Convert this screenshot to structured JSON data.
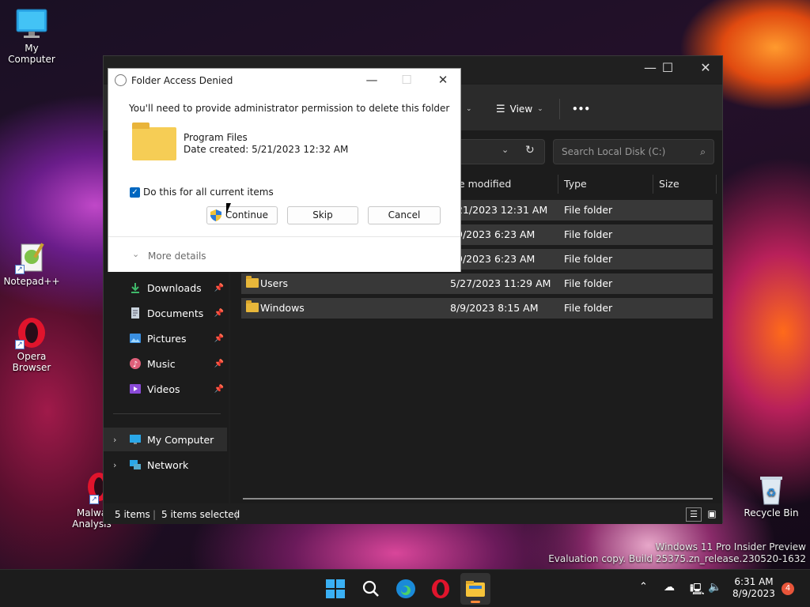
{
  "desktop": {
    "icons": [
      {
        "label": "My Computer"
      },
      {
        "label": "Notepad++"
      },
      {
        "label": "Opera Browser"
      },
      {
        "label": "Malwa Analysis"
      },
      {
        "label": "Recycle Bin"
      }
    ],
    "watermark": {
      "line1": "Windows 11 Pro Insider Preview",
      "line2": "Evaluation copy. Build 25375.zn_release.230520-1632"
    }
  },
  "explorer": {
    "toolbar": {
      "view_label": "View",
      "more_label": "•••"
    },
    "search_placeholder": "Search Local Disk (C:)",
    "columns": {
      "date": "te modified",
      "type": "Type",
      "size": "Size"
    },
    "rows": [
      {
        "name": "",
        "date": "21/2023 12:31 AM",
        "type": "File folder"
      },
      {
        "name": "",
        "date": "9/2023 6:23 AM",
        "type": "File folder"
      },
      {
        "name": "",
        "date": "9/2023 6:23 AM",
        "type": "File folder"
      },
      {
        "name": "Users",
        "date": "5/27/2023 11:29 AM",
        "type": "File folder"
      },
      {
        "name": "Windows",
        "date": "8/9/2023 8:15 AM",
        "type": "File folder"
      }
    ],
    "sidebar": {
      "downloads": "Downloads",
      "documents": "Documents",
      "pictures": "Pictures",
      "music": "Music",
      "videos": "Videos",
      "my_computer": "My Computer",
      "network": "Network"
    },
    "status": {
      "items": "5 items",
      "selected": "5 items selected"
    }
  },
  "dialog": {
    "title": "Folder Access Denied",
    "message": "You'll need to provide administrator permission to delete this folder",
    "folder_name": "Program Files",
    "date_created": "Date created: 5/21/2023 12:32 AM",
    "checkbox_label": "Do this for all current items",
    "continue_label": "Continue",
    "skip_label": "Skip",
    "cancel_label": "Cancel",
    "more_details": "More details"
  },
  "taskbar": {
    "time": "6:31 AM",
    "date": "8/9/2023",
    "notification_count": "4"
  },
  "colors": {
    "accent": "#0067c0",
    "folder": "#e8b73a",
    "explorer_bg": "#1c1c1c",
    "taskbar_bg": "#1c1c1c"
  }
}
